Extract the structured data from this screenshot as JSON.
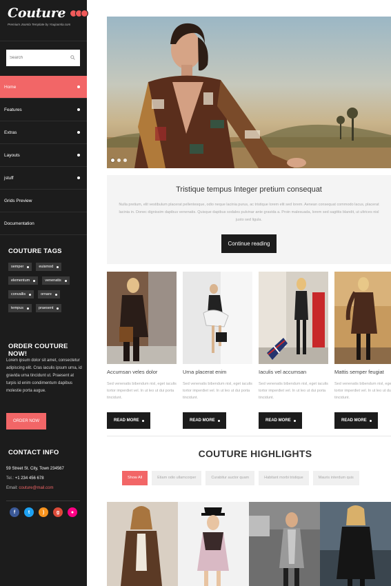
{
  "brand": {
    "logo": "Couture",
    "tagline": "Premium Joomla Template by Youjoomla.com"
  },
  "search": {
    "placeholder": "Search"
  },
  "nav": {
    "items": [
      {
        "label": "Home",
        "active": true
      },
      {
        "label": "Features"
      },
      {
        "label": "Extras"
      },
      {
        "label": "Layouts"
      },
      {
        "label": "jstuff"
      },
      {
        "label": "Grids Preview"
      },
      {
        "label": "Documentation"
      }
    ]
  },
  "tags": {
    "title": "COUTURE TAGS",
    "items": [
      "semper",
      "euismod",
      "elementum",
      "venenatis",
      "convallis",
      "ornare",
      "tempus",
      "praesent"
    ]
  },
  "order": {
    "title": "ORDER COUTURE NOW!",
    "text": "Lorem ipsum dolor sit amet, consectetur adipiscing elit. Cras iaculis ipsum urna, id gravida urna tincidunt ut. Praesent at turpis id enim condimentum dapibus molestie porta augue.",
    "button": "ORDER NOW"
  },
  "contact": {
    "title": "CONTACT INFO",
    "address": "59 Street St. City, Town 234567",
    "tel_label": "Tel.:",
    "tel": "+1 234 456 678",
    "email_label": "Email:",
    "email": "couture@mail.com"
  },
  "social": [
    "facebook-icon",
    "twitter-icon",
    "rss-icon",
    "google-plus-icon",
    "flickr-icon"
  ],
  "feature": {
    "title": "Tristique tempus Integer pretium consequat",
    "text": "Nulla pretium, elit vestibulum placerat pellentesque, odio neque lacinia purus, ac tristique lorem elit sed lorem. Aenean consequat commodo lacus, placerat lacinia in. Donec dignissim dapibus venenatis. Quisque dapibus sodales pulvinar ante gravida a. Proin malesuada, lorem sed sagittis blandit, ut ultrices nisl justo sed ligula.",
    "button": "Continue reading"
  },
  "cards": [
    {
      "title": "Accumsan veles dolor",
      "text": "Sed venenatis bibendum nisl, eget iaculis tortor imperdiet vel. In ut leo ut dui porta tincidunt.",
      "button": "READ MORE"
    },
    {
      "title": "Urna placerat enim",
      "text": "Sed venenatis bibendum nisl, eget iaculis tortor imperdiet vel. In ut leo ut dui porta tincidunt.",
      "button": "READ MORE"
    },
    {
      "title": "Iaculis vel accumsan",
      "text": "Sed venenatis bibendum nisl, eget iaculis tortor imperdiet vel. In ut leo ut dui porta tincidunt.",
      "button": "READ MORE"
    },
    {
      "title": "Mattis semper feugiat",
      "text": "Sed venenatis bibendum nisl, eget iaculis tortor imperdiet vel. In ut leo ut dui porta tincidunt.",
      "button": "READ MORE"
    }
  ],
  "highlights": {
    "title": "COUTURE HIGHLIGHTS",
    "filters": [
      {
        "label": "Show All",
        "active": true
      },
      {
        "label": "Etiam odio ullamcorper"
      },
      {
        "label": "Curabitur auctor quam"
      },
      {
        "label": "Habitant morbi tristique"
      },
      {
        "label": "Mauris interdum quis"
      }
    ]
  },
  "colors": {
    "accent": "#f26667",
    "sidebar": "#1c1c1c",
    "button_dark": "#1c1c1c"
  }
}
